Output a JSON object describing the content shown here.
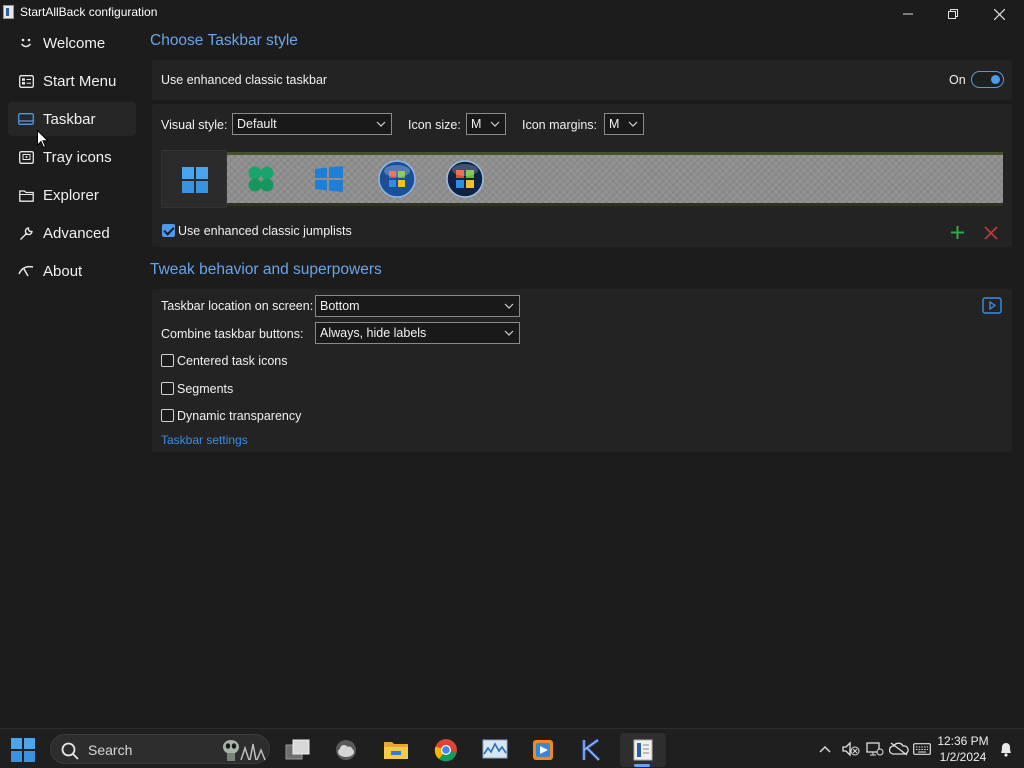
{
  "window": {
    "title": "StartAllBack configuration"
  },
  "sidebar": {
    "items": [
      {
        "label": "Welcome",
        "icon": "smile-icon"
      },
      {
        "label": "Start Menu",
        "icon": "start-menu-icon"
      },
      {
        "label": "Taskbar",
        "icon": "taskbar-icon",
        "active": true
      },
      {
        "label": "Tray icons",
        "icon": "tray-icon"
      },
      {
        "label": "Explorer",
        "icon": "folder-icon"
      },
      {
        "label": "Advanced",
        "icon": "wrench-icon"
      },
      {
        "label": "About",
        "icon": "about-icon"
      }
    ]
  },
  "style_section": {
    "title": "Choose Taskbar style",
    "enhanced_taskbar_label": "Use enhanced classic taskbar",
    "toggle_state": "On",
    "visual_style_label": "Visual style:",
    "visual_style_value": "Default",
    "icon_size_label": "Icon size:",
    "icon_size_value": "M",
    "icon_margins_label": "Icon margins:",
    "icon_margins_value": "M",
    "jumplists_label": "Use enhanced classic jumplists",
    "jumplists_checked": true
  },
  "behavior_section": {
    "title": "Tweak behavior and superpowers",
    "location_label": "Taskbar location on screen:",
    "location_value": "Bottom",
    "combine_label": "Combine taskbar buttons:",
    "combine_value": "Always, hide labels",
    "centered_label": "Centered task icons",
    "segments_label": "Segments",
    "transparency_label": "Dynamic transparency",
    "settings_link": "Taskbar settings"
  },
  "taskbar": {
    "search_label": "Search",
    "clock_time": "12:36 PM",
    "clock_date": "1/2/2024"
  },
  "colors": {
    "accent": "#4c9ae8",
    "section_title": "#6aa4e8",
    "background": "#1c1c1c",
    "panel": "#232323"
  }
}
